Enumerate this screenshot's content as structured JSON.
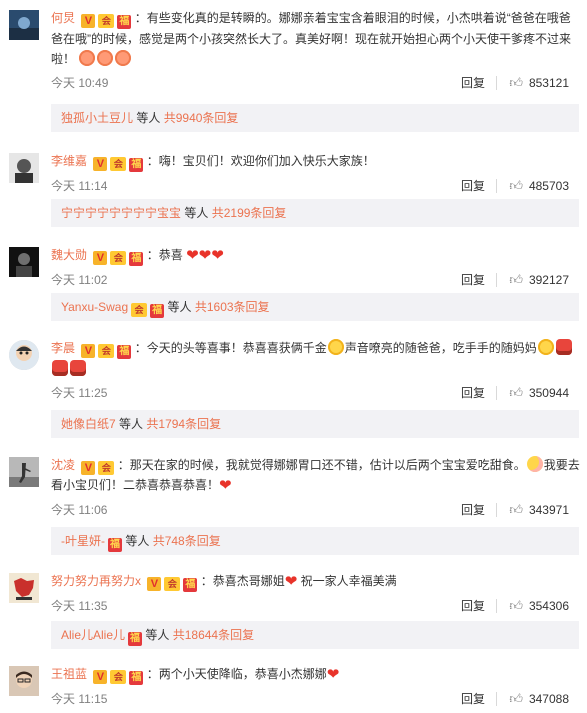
{
  "ui": {
    "reply_label": "回复",
    "others_text": "等人",
    "badge_v": "V",
    "badge_club": "会",
    "badge_red": "福",
    "heart": "❤",
    "thumb_icon": "thumbs-up-icon"
  },
  "comments": [
    {
      "user": "何炅",
      "text1": "：有些变化真的是转瞬的。娜娜亲着宝宝含着眼泪的时候，小杰哄着说“爸爸在哦爸爸在哦”的时候，感觉是两个小孩突然长大了。真美好啊！现在就开始担心两个小天使干爹疼不过来啦！",
      "time": "今天 10:49",
      "likes": "853121",
      "reply_user": "独孤小土豆儿",
      "reply_count": "共9940条回复"
    },
    {
      "user": "李维嘉",
      "text1": "：嗨！宝贝们！欢迎你们加入快乐大家族！",
      "time": "今天 11:14",
      "likes": "485703",
      "reply_user": "宁宁宁宁宁宁宁宁宝宝",
      "reply_count": "共2199条回复"
    },
    {
      "user": "魏大勋",
      "text1": "：恭喜",
      "time": "今天 11:02",
      "likes": "392127",
      "reply_user": "Yanxu-Swag",
      "reply_count": "共1603条回复"
    },
    {
      "user": "李晨",
      "text1": "：今天的头等喜事！恭喜喜获俩千金",
      "text2": "声音嘹亮的随爸爸，吃手手的随妈妈",
      "time": "今天 11:25",
      "likes": "350944",
      "reply_user": "她像白纸7",
      "reply_count": "共1794条回复"
    },
    {
      "user": "沈凌",
      "text1": "：那天在家的时候，我就觉得娜娜胃口还不错，估计以后两个宝宝爱吃甜食。",
      "text2": "我要去看小宝贝们！二恭喜恭喜恭喜！",
      "time": "今天 11:06",
      "likes": "343971",
      "reply_user": "-叶星妍-",
      "reply_count": "共748条回复"
    },
    {
      "user": "努力努力再努力x",
      "text1": "：恭喜杰哥娜姐",
      "text2": " 祝一家人幸福美满",
      "time": "今天 11:35",
      "likes": "354306",
      "reply_user": "Alie儿Alie儿",
      "reply_count": "共18644条回复"
    },
    {
      "user": "王祖蓝",
      "text1": "：两个小天使降临，恭喜小杰娜娜",
      "time": "今天 11:15",
      "likes": "347088"
    }
  ]
}
